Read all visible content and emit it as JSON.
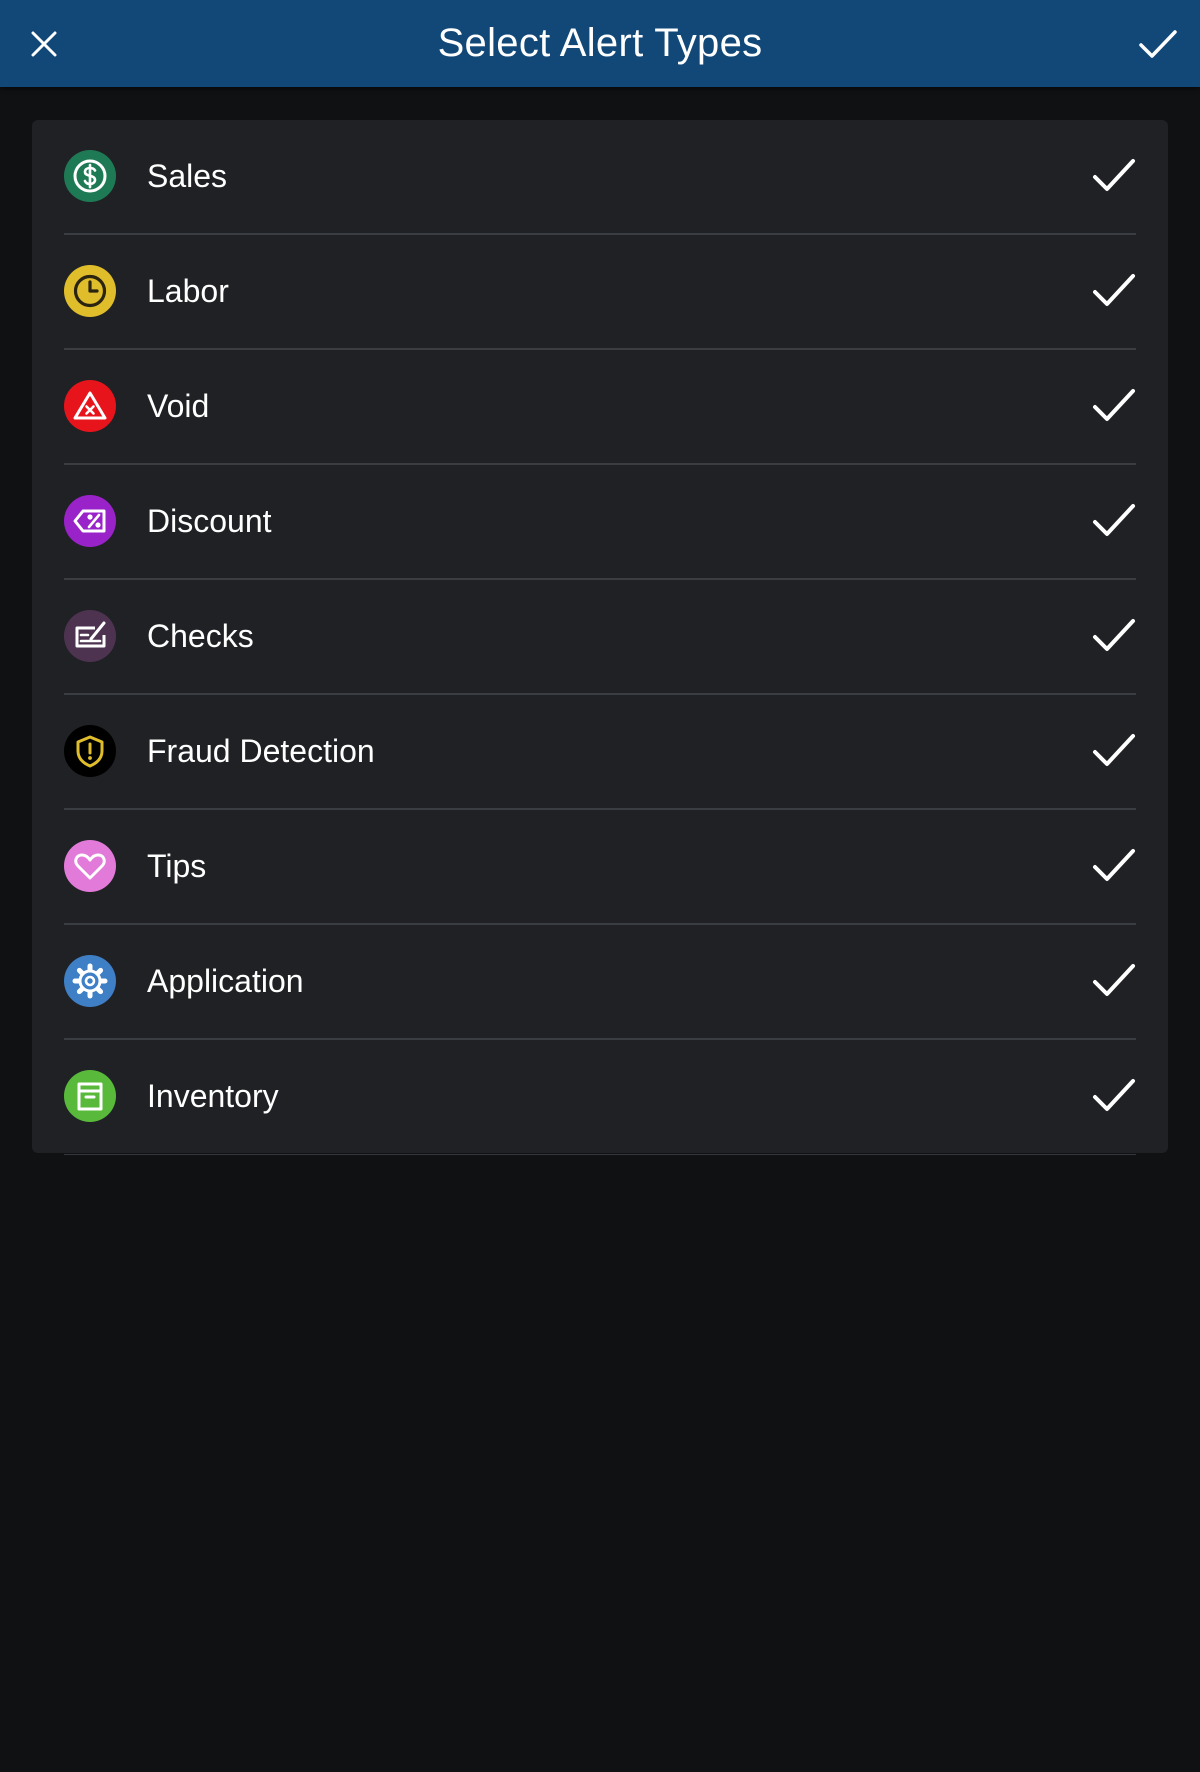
{
  "header": {
    "title": "Select Alert Types",
    "close_icon": "close-icon",
    "confirm_icon": "check-icon",
    "background": "#124878"
  },
  "alert_types": [
    {
      "label": "Sales",
      "icon": "dollar-circle-icon",
      "color": "#1e7a55",
      "selected": true
    },
    {
      "label": "Labor",
      "icon": "clock-icon",
      "color": "#e0bd2a",
      "selected": true
    },
    {
      "label": "Void",
      "icon": "warning-triangle-icon",
      "color": "#e8141c",
      "selected": true
    },
    {
      "label": "Discount",
      "icon": "discount-tag-icon",
      "color": "#9a22c9",
      "selected": true
    },
    {
      "label": "Checks",
      "icon": "check-pen-icon",
      "color": "#4d3350",
      "selected": true
    },
    {
      "label": "Fraud Detection",
      "icon": "shield-alert-icon",
      "color": "#000000",
      "selected": true
    },
    {
      "label": "Tips",
      "icon": "heart-icon",
      "color": "#e27ad9",
      "selected": true
    },
    {
      "label": "Application",
      "icon": "gear-icon",
      "color": "#3e7fc6",
      "selected": true
    },
    {
      "label": "Inventory",
      "icon": "archive-box-icon",
      "color": "#58b93b",
      "selected": true
    }
  ]
}
